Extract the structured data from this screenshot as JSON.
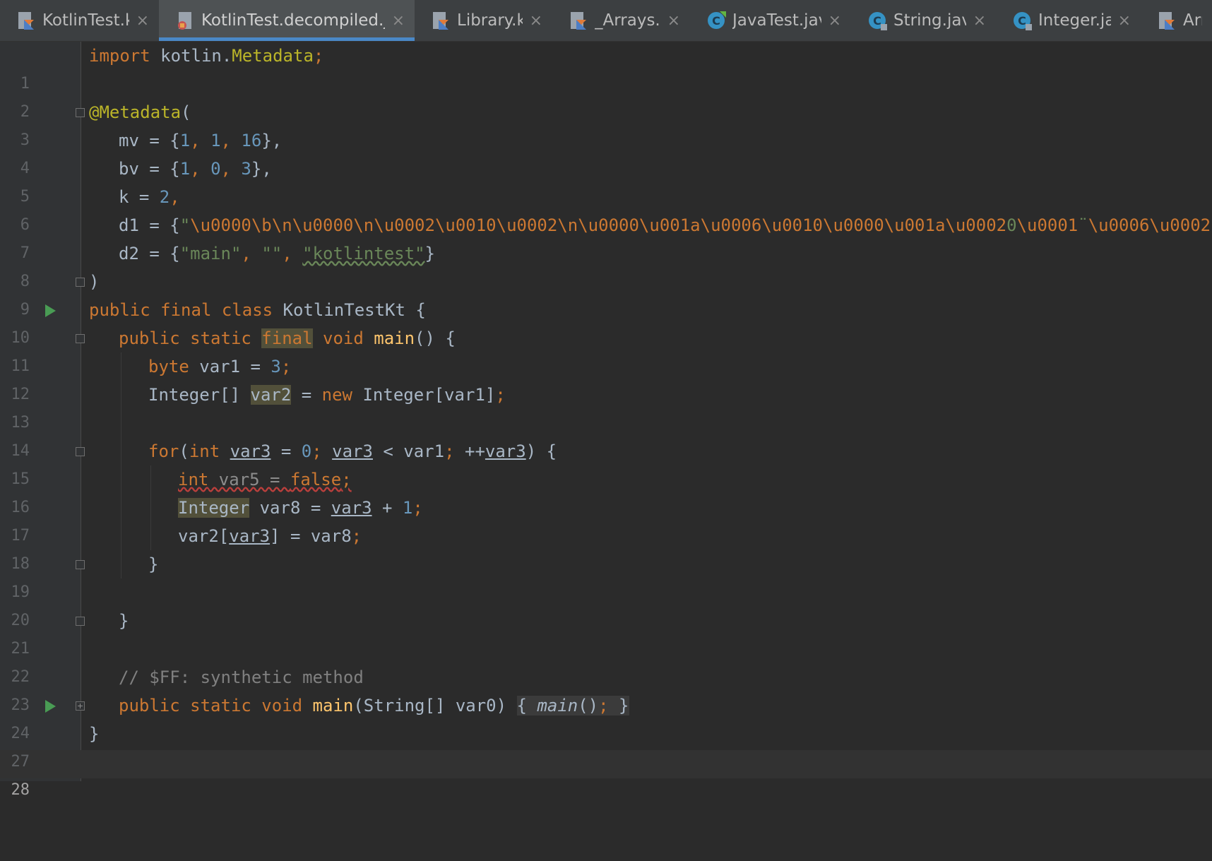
{
  "tabs": [
    {
      "label": "KotlinTest.k",
      "icon": "kotlin-file-icon",
      "active": false
    },
    {
      "label": "KotlinTest.decompiled.ja",
      "icon": "java-decompiled-file-icon",
      "active": true
    },
    {
      "label": "Library.k",
      "icon": "kotlin-file-icon",
      "active": false
    },
    {
      "label": "_Arrays.k",
      "icon": "kotlin-file-icon",
      "active": false
    },
    {
      "label": "JavaTest.jav",
      "icon": "java-class-icon",
      "active": false
    },
    {
      "label": "String.jav",
      "icon": "java-class-icon",
      "active": false
    },
    {
      "label": "Integer.jav",
      "icon": "java-class-icon",
      "active": false
    },
    {
      "label": "Arra",
      "icon": "kotlin-file-icon",
      "active": false
    }
  ],
  "tab_close_glyph": "×",
  "editor": {
    "line_numbers": [
      "1",
      "2",
      "3",
      "4",
      "5",
      "6",
      "7",
      "8",
      "9",
      "10",
      "11",
      "12",
      "13",
      "14",
      "15",
      "16",
      "17",
      "18",
      "19",
      "20",
      "21",
      "22",
      "23",
      "24",
      "27",
      "28"
    ],
    "current_line": "28",
    "code": {
      "l1_import": "import",
      "l1_pkg": " kotlin.",
      "l1_cls": "Metadata",
      "l1_semi": ";",
      "l3_ann": "@Metadata",
      "l3_paren": "(",
      "l4_key": "mv = {",
      "l4_v1": "1",
      "l4_c1": ", ",
      "l4_v2": "1",
      "l4_c2": ", ",
      "l4_v3": "16",
      "l4_end": "},",
      "l5_key": "bv = {",
      "l5_v1": "1",
      "l5_c1": ", ",
      "l5_v2": "0",
      "l5_c2": ", ",
      "l5_v3": "3",
      "l5_end": "},",
      "l6_key": "k = ",
      "l6_v": "2",
      "l6_end": ",",
      "l7_key": "d1 = {",
      "l7_q1": "\"",
      "l7_esc1": "\\u0000\\b\\n\\u0000\\n\\u0002\\u0010\\u0002\\n\\u0000\\u001a\\u0006\\u0010\\u0000\\u001a\\u0002",
      "l7_mid": "0",
      "l7_esc2": "\\u0001",
      "l7_sym": "¨",
      "l7_esc3": "\\u0006\\u0002",
      "l7_q2": "\"",
      "l7_end": "},",
      "l8_key": "d2 = {",
      "l8_s1": "\"main\"",
      "l8_c1": ", ",
      "l8_s2": "\"\"",
      "l8_c2": ", ",
      "l8_s3": "\"kotlintest\"",
      "l8_end": "}",
      "l9": ")",
      "l10_mods": "public final class",
      "l10_name": " KotlinTestKt {",
      "l11_mods": "public static ",
      "l11_final": "final",
      "l11_void": " void ",
      "l11_fn": "main",
      "l11_end": "() {",
      "l12_type": "byte",
      "l12_rest": " var1 = ",
      "l12_num": "3",
      "l12_semi": ";",
      "l13_type": "Integer[] ",
      "l13_var": "var2",
      "l13_eq": " = ",
      "l13_new": "new",
      "l13_rest": " Integer[var1]",
      "l13_semi": ";",
      "l15_for": "for",
      "l15_p": "(",
      "l15_int": "int",
      "l15_sp": " ",
      "l15_v1": "var3",
      "l15_eq": " = ",
      "l15_zero": "0",
      "l15_s1": "; ",
      "l15_v2": "var3",
      "l15_lt": " < var1",
      "l15_s2": "; ",
      "l15_inc": "++",
      "l15_v3": "var3",
      "l15_end": ") {",
      "l16_int": "int",
      "l16_rest": " var5 = ",
      "l16_false": "false",
      "l16_semi": ";",
      "l17_type": "Integer",
      "l17_rest": " var8 = ",
      "l17_var": "var3",
      "l17_plus": " + ",
      "l17_num": "1",
      "l17_semi": ";",
      "l18_a": "var2[",
      "l18_var": "var3",
      "l18_b": "] = var8",
      "l18_semi": ";",
      "l19": "}",
      "l21": "}",
      "l23": "// $FF: synthetic method",
      "l24_mods": "public static void ",
      "l24_fn": "main",
      "l24_args": "(String[] var0) ",
      "l24_open": "{ ",
      "l24_call": "main",
      "l24_callp": "()",
      "l24_semi": ";",
      "l24_close": " }",
      "l27": "}"
    }
  },
  "colors": {
    "keyword": "#cc7832",
    "annotation": "#bbb529",
    "number": "#6897bb",
    "string": "#6a8759",
    "comment": "#808080",
    "function": "#ffc66d",
    "plain": "#a9b7c6",
    "background": "#2b2b2b",
    "run_marker": "#499c54"
  }
}
